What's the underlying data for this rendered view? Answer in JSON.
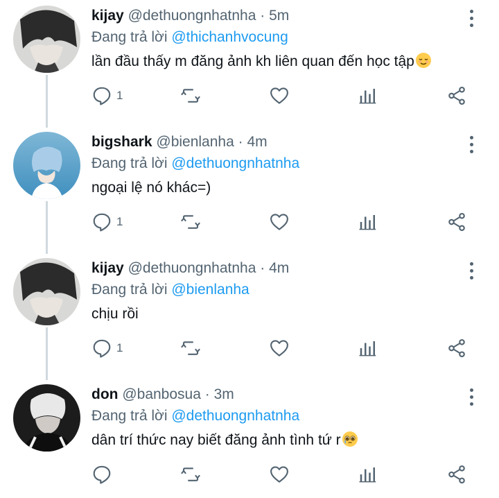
{
  "reply_prefix": "Đang trả lời",
  "icons": [
    "reply-icon",
    "retweet-icon",
    "like-icon",
    "analytics-icon",
    "share-icon",
    "more-options-icon"
  ],
  "colors": {
    "link": "#1d9bf0",
    "muted": "#536471",
    "text": "#0f1419",
    "thread_line": "#cfd9de"
  },
  "tweets": [
    {
      "name": "kijay",
      "handle": "@dethuongnhatnha",
      "time": "5m",
      "reply_to": "@thichanhvocung",
      "text": "lần đầu thấy m đăng ảnh kh liên quan đến học tập",
      "emoji": "relieved-face-emoji",
      "reply_count": "1"
    },
    {
      "name": "bigshark",
      "handle": "@bienlanha",
      "time": "4m",
      "reply_to": "@dethuongnhatnha",
      "text": "ngoại lệ nó khác=)",
      "emoji": "",
      "reply_count": "1"
    },
    {
      "name": "kijay",
      "handle": "@dethuongnhatnha",
      "time": "4m",
      "reply_to": "@bienlanha",
      "text": "chịu rồi",
      "emoji": "",
      "reply_count": "1"
    },
    {
      "name": "don",
      "handle": "@banbosua",
      "time": "3m",
      "reply_to": "@dethuongnhatnha",
      "text": "dân trí thức nay biết đăng ảnh tình tứ r",
      "emoji": "pleading-face-emoji",
      "reply_count": ""
    }
  ]
}
